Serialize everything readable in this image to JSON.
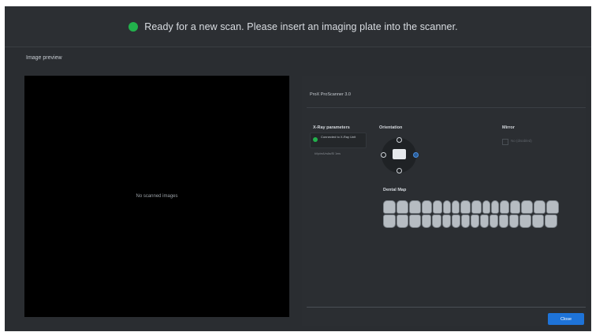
{
  "status": {
    "message": "Ready for a new scan. Please insert an imaging plate into the scanner.",
    "indicator_color": "#22b14c"
  },
  "preview": {
    "label": "Image preview",
    "empty_text": "No scanned images"
  },
  "scanner": {
    "title": "ProX ProScanner 3.0"
  },
  "xray": {
    "title": "X-Ray parameters",
    "connection_status": "Connected to X-Ray Unit",
    "subtext": "kVp/mA/mAs/S/ 1ms"
  },
  "orientation": {
    "title": "Orientation",
    "selected": "right"
  },
  "mirror": {
    "title": "Mirror",
    "option_label": "No (disabled)",
    "checked": false
  },
  "dental_map": {
    "title": "Dental Map",
    "upper_count": 16,
    "lower_count": 16
  },
  "footer": {
    "close_label": "Close"
  },
  "colors": {
    "accent": "#1e73d8",
    "status_green": "#22b14c",
    "background": "#2a2d31"
  }
}
